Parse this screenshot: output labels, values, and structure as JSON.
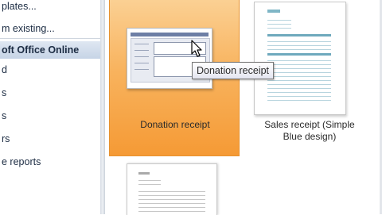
{
  "sidebar": {
    "items": [
      {
        "label": "plates...",
        "selected": false
      },
      {
        "label": "m existing...",
        "selected": false
      },
      {
        "label": "oft Office Online",
        "selected": true
      },
      {
        "label": "d",
        "selected": false
      },
      {
        "label": "s",
        "selected": false
      },
      {
        "label": "s",
        "selected": false
      },
      {
        "label": "rs",
        "selected": false
      },
      {
        "label": "e reports",
        "selected": false
      }
    ]
  },
  "gallery": {
    "templates": [
      {
        "title": "Donation receipt",
        "selected": true
      },
      {
        "title_line1": "Sales receipt (Simple",
        "title_line2": "Blue design)",
        "selected": false
      }
    ]
  },
  "tooltip": {
    "text": "Donation receipt"
  },
  "colors": {
    "selection_orange": "#f8b35e",
    "sidebar_selected": "#c6d4e6",
    "tooltip_border": "#767676"
  }
}
